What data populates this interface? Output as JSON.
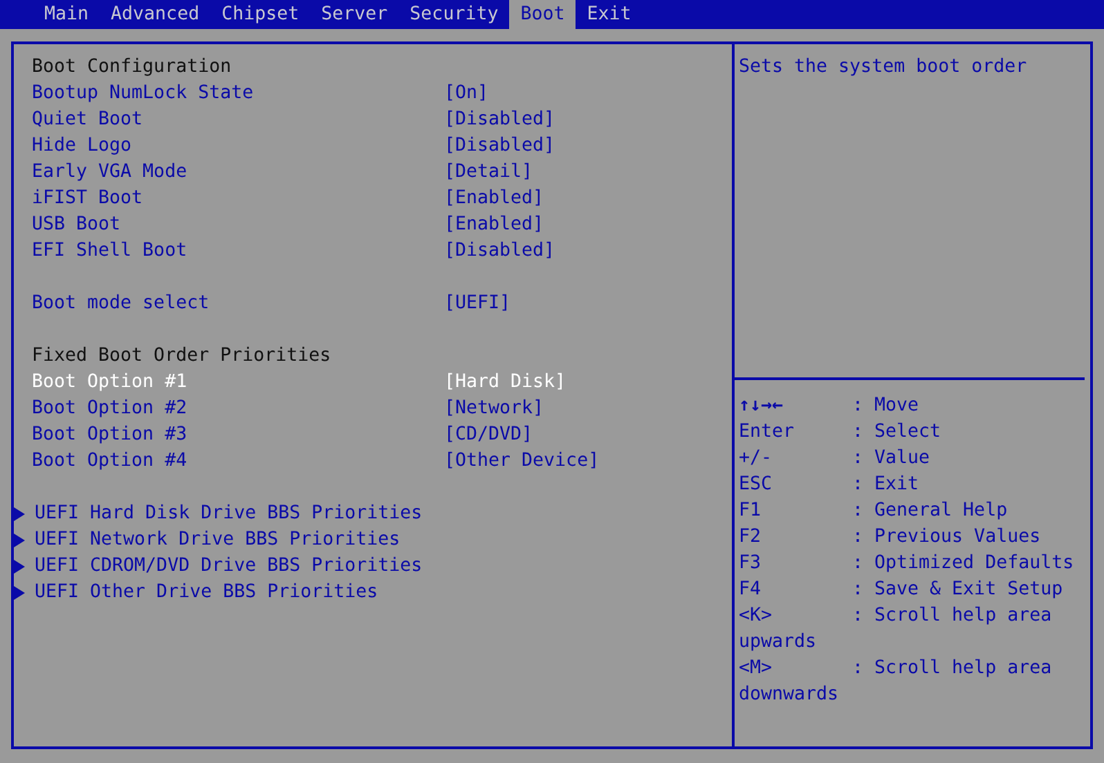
{
  "tabs": [
    {
      "label": "Main",
      "selected": false
    },
    {
      "label": "Advanced",
      "selected": false
    },
    {
      "label": "Chipset",
      "selected": false
    },
    {
      "label": "Server",
      "selected": false
    },
    {
      "label": "Security",
      "selected": false
    },
    {
      "label": "Boot",
      "selected": true
    },
    {
      "label": "Exit",
      "selected": false
    }
  ],
  "settings": [
    {
      "kind": "heading",
      "label": "Boot Configuration"
    },
    {
      "kind": "setting",
      "label": "Bootup NumLock State",
      "value": "[On]",
      "selected": false
    },
    {
      "kind": "setting",
      "label": "Quiet Boot",
      "value": "[Disabled]",
      "selected": false
    },
    {
      "kind": "setting",
      "label": "Hide Logo",
      "value": "[Disabled]",
      "selected": false
    },
    {
      "kind": "setting",
      "label": "Early VGA Mode",
      "value": "[Detail]",
      "selected": false
    },
    {
      "kind": "setting",
      "label": "iFIST Boot",
      "value": "[Enabled]",
      "selected": false
    },
    {
      "kind": "setting",
      "label": "USB Boot",
      "value": "[Enabled]",
      "selected": false
    },
    {
      "kind": "setting",
      "label": "EFI Shell Boot",
      "value": "[Disabled]",
      "selected": false
    },
    {
      "kind": "blank"
    },
    {
      "kind": "setting",
      "label": "Boot mode select",
      "value": "[UEFI]",
      "selected": false
    },
    {
      "kind": "blank"
    },
    {
      "kind": "heading",
      "label": "Fixed Boot Order Priorities"
    },
    {
      "kind": "setting",
      "label": "Boot Option #1",
      "value": "[Hard Disk]",
      "selected": true
    },
    {
      "kind": "setting",
      "label": "Boot Option #2",
      "value": "[Network]",
      "selected": false
    },
    {
      "kind": "setting",
      "label": "Boot Option #3",
      "value": "[CD/DVD]",
      "selected": false
    },
    {
      "kind": "setting",
      "label": "Boot Option #4",
      "value": "[Other Device]",
      "selected": false
    },
    {
      "kind": "blank"
    },
    {
      "kind": "submenu",
      "label": "UEFI Hard Disk Drive BBS Priorities",
      "selected": false
    },
    {
      "kind": "submenu",
      "label": "UEFI Network Drive BBS Priorities",
      "selected": false
    },
    {
      "kind": "submenu",
      "label": "UEFI CDROM/DVD Drive BBS Priorities",
      "selected": false
    },
    {
      "kind": "submenu",
      "label": "UEFI Other Drive BBS Priorities",
      "selected": false
    }
  ],
  "help": {
    "text": "Sets the system boot order"
  },
  "legend": [
    {
      "key": "↑↓→←",
      "action": ": Move"
    },
    {
      "key": "Enter",
      "action": ": Select"
    },
    {
      "key": "+/-",
      "action": ": Value"
    },
    {
      "key": "ESC",
      "action": ": Exit"
    },
    {
      "key": "F1",
      "action": ": General Help"
    },
    {
      "key": "F2",
      "action": ": Previous Values"
    },
    {
      "key": "F3",
      "action": ": Optimized Defaults"
    },
    {
      "key": "F4",
      "action": ": Save & Exit Setup"
    },
    {
      "key": "<K>",
      "action": ": Scroll help area",
      "continuation": "upwards"
    },
    {
      "key": "<M>",
      "action": ": Scroll help area",
      "continuation": "downwards"
    }
  ]
}
